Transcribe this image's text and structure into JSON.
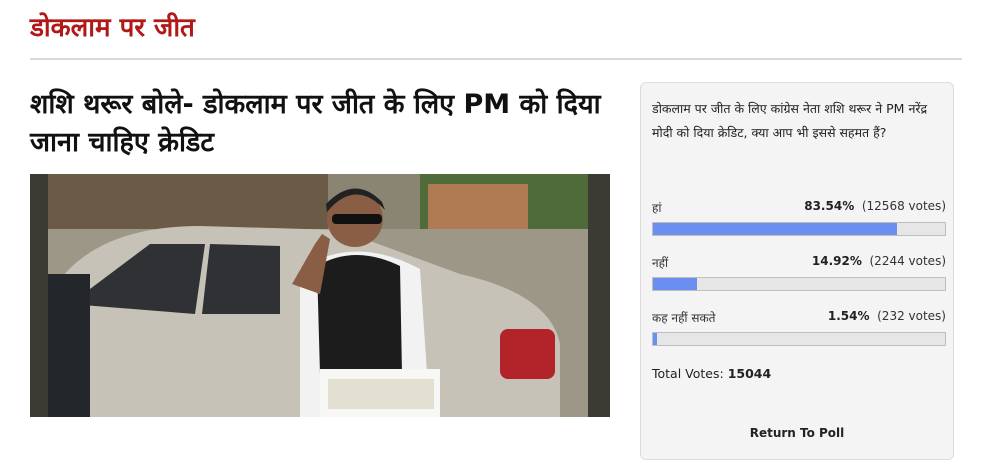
{
  "section": {
    "title": "डोकलाम पर जीत"
  },
  "article": {
    "headline": "शशि थरूर बोले- डोकलाम पर जीत के लिए PM को दिया जाना चाहिए क्रेडिट"
  },
  "poll": {
    "question": "डोकलाम पर जीत के लिए कांग्रेस नेता शशि थरूर ने PM नरेंद्र मोदी को दिया क्रेडिट, क्या आप भी इससे सहमत हैं?",
    "options": [
      {
        "label": "हां",
        "percent": "83.54%",
        "votes": "(12568 votes)",
        "fraction": 0.8354
      },
      {
        "label": "नहीं",
        "percent": "14.92%",
        "votes": "(2244 votes)",
        "fraction": 0.1492
      },
      {
        "label": "कह नहीं सकते",
        "percent": "1.54%",
        "votes": "(232 votes)",
        "fraction": 0.0154
      }
    ],
    "total_label": "Total Votes:",
    "total_value": "15044",
    "return_label": "Return To Poll",
    "bar_color": "#6a8ff0"
  },
  "colors": {
    "section_title": "#b11919"
  }
}
